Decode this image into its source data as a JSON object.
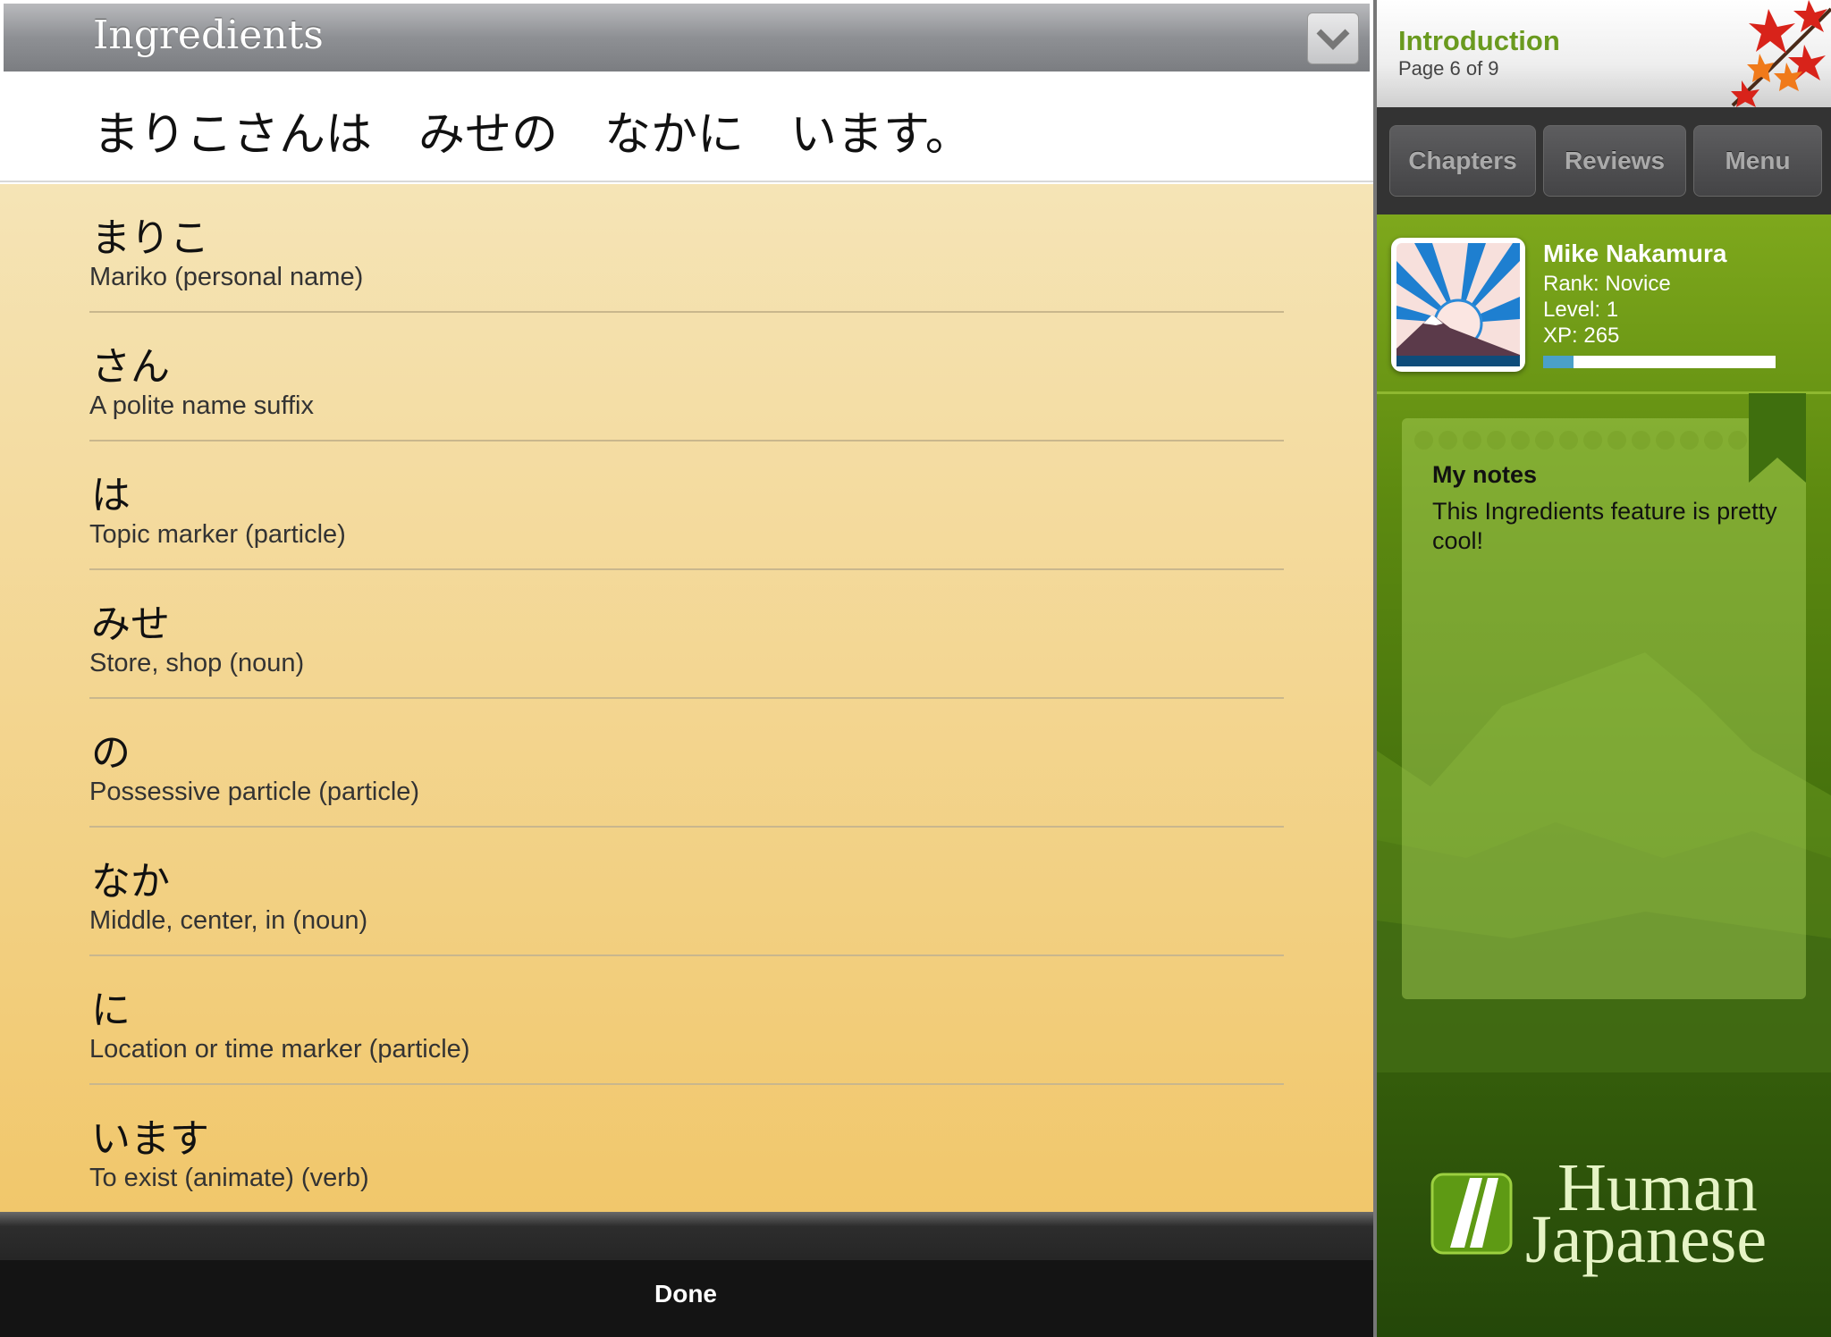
{
  "ingredients": {
    "title": "Ingredients",
    "sentence": "まりこさんは　みせの　なかに　います。",
    "items": [
      {
        "jp": "まりこ",
        "en": "Mariko (personal name)"
      },
      {
        "jp": "さん",
        "en": "A polite name suffix"
      },
      {
        "jp": "は",
        "en": "Topic marker (particle)"
      },
      {
        "jp": "みせ",
        "en": "Store, shop (noun)"
      },
      {
        "jp": "の",
        "en": "Possessive particle (particle)"
      },
      {
        "jp": "なか",
        "en": "Middle, center, in (noun)"
      },
      {
        "jp": "に",
        "en": "Location or time marker (particle)"
      },
      {
        "jp": "います",
        "en": "To exist (animate) (verb)"
      }
    ],
    "done_label": "Done"
  },
  "sidebar": {
    "chapter": "Introduction",
    "page": "Page 6 of 9",
    "buttons": [
      "Chapters",
      "Reviews",
      "Menu"
    ],
    "profile": {
      "name": "Mike Nakamura",
      "rank": "Rank: Novice",
      "level": "Level: 1",
      "xp": "XP: 265",
      "xp_progress_percent": 13
    },
    "notes": {
      "heading": "My notes",
      "text": "This Ingredients feature is pretty cool!"
    },
    "logo": {
      "line1": "Human",
      "line2": "Japanese"
    }
  },
  "colors": {
    "accent_green": "#6a9a1f",
    "xp_bar": "#4aa0c8"
  }
}
